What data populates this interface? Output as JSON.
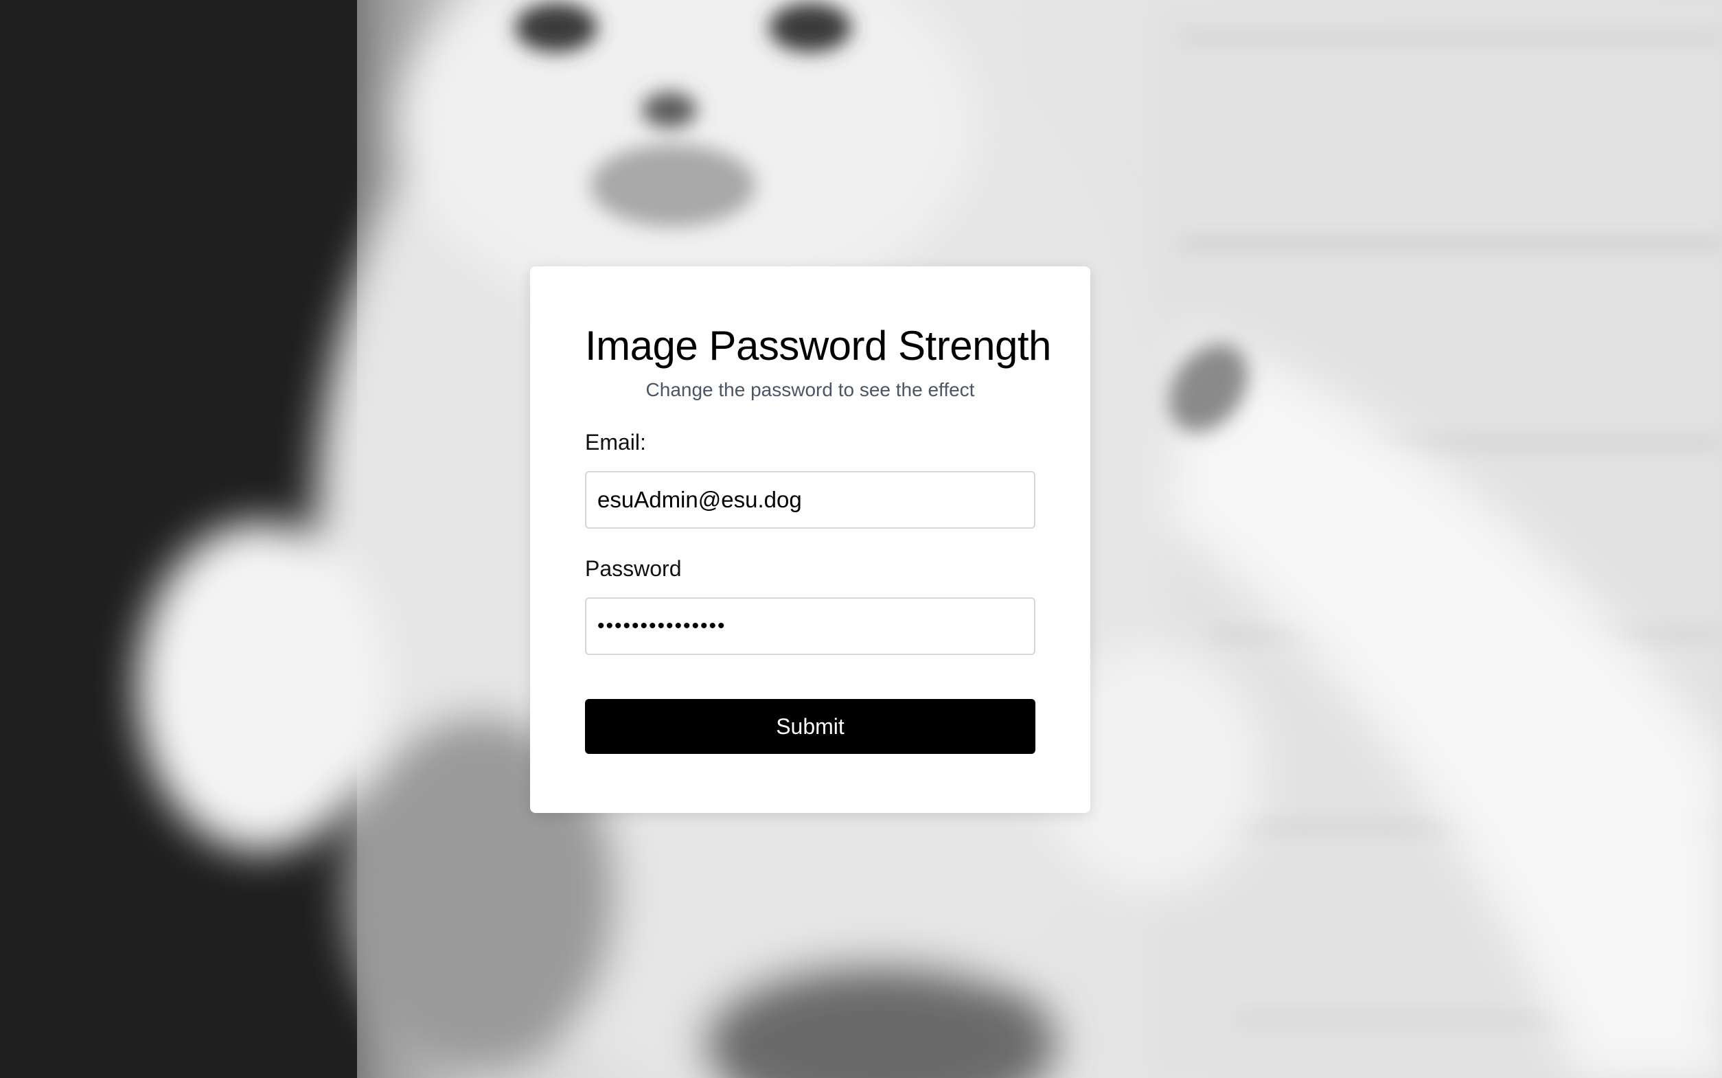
{
  "page": {
    "title": "Image Password Strength",
    "subtitle": "Change the password to see the effect"
  },
  "background": {
    "image": "greyscale-kitten-photo"
  },
  "form": {
    "email": {
      "label": "Email:",
      "value": "esuAdmin@esu.dog"
    },
    "password": {
      "label": "Password",
      "value": "•••••••••••••••"
    },
    "submit_label": "Submit"
  },
  "colors": {
    "button_background": "#000000",
    "button_text": "#ffffff",
    "card_background": "#ffffff",
    "subtitle_text": "#4b5563"
  }
}
